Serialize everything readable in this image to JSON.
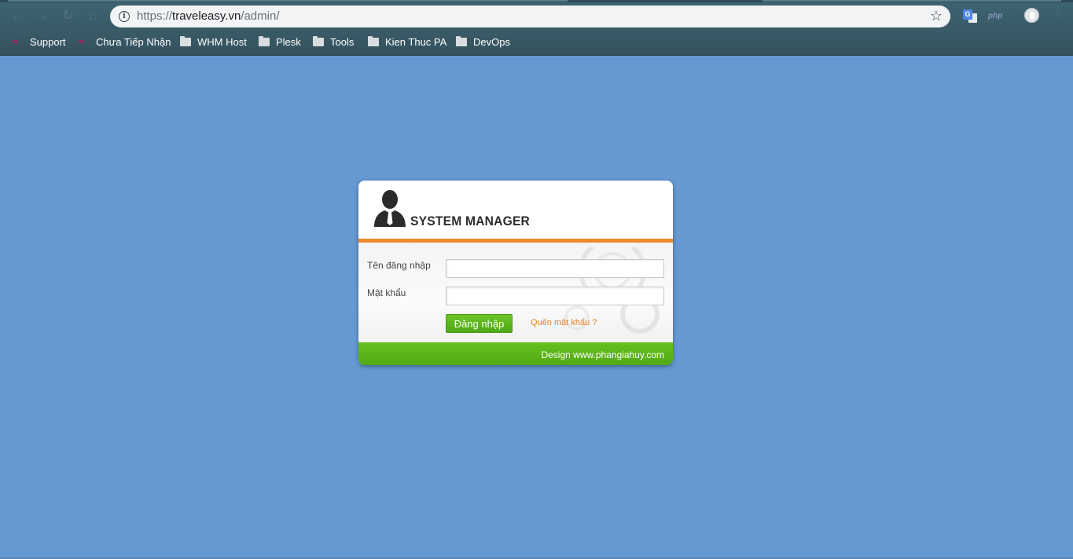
{
  "browser": {
    "url": {
      "scheme": "https://",
      "host": "traveleasy.vn",
      "path": "/admin/"
    },
    "icons": {
      "back": "arrow-left-icon",
      "forward": "arrow-right-icon",
      "reload": "reload-icon",
      "home": "home-icon",
      "info": "info-icon",
      "bookmark": "star-icon",
      "translate": "google-translate-icon",
      "php": "php",
      "profile": "profile-icon",
      "menu": "kebab-menu-icon"
    },
    "bookmarks": [
      {
        "label": "Support",
        "icon": "favicon"
      },
      {
        "label": "Chưa Tiếp Nhận",
        "icon": "favicon"
      },
      {
        "label": "WHM Host",
        "icon": "folder"
      },
      {
        "label": "Plesk",
        "icon": "folder"
      },
      {
        "label": "Tools",
        "icon": "folder"
      },
      {
        "label": "Kien Thuc PA",
        "icon": "folder"
      },
      {
        "label": "DevOps",
        "icon": "folder"
      }
    ]
  },
  "login": {
    "title": "SYSTEM MANAGER",
    "username_label": "Tên đăng nhập",
    "username_value": "",
    "password_label": "Mật khẩu",
    "password_value": "",
    "submit_label": "Đăng nhập",
    "forgot_label": "Quên mật khẩu ?",
    "credit": "Design www.phangiahuy.com"
  },
  "colors": {
    "page_background": "#6699d2",
    "accent_orange": "#ef8a2a",
    "accent_green": "#5cb41a"
  }
}
